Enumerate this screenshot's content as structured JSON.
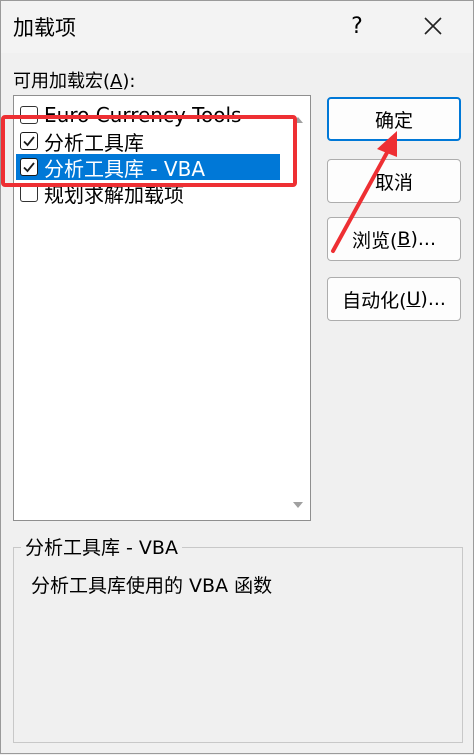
{
  "dialog": {
    "title": "加载项",
    "help_label": "?"
  },
  "addins": {
    "label_prefix": "可用加载宏(",
    "label_accel": "A",
    "label_suffix": "):",
    "items": [
      {
        "label": "Euro Currency Tools",
        "checked": false,
        "selected": false
      },
      {
        "label": "分析工具库",
        "checked": true,
        "selected": false
      },
      {
        "label": "分析工具库 - VBA",
        "checked": true,
        "selected": true
      },
      {
        "label": "规划求解加载项",
        "checked": false,
        "selected": false
      }
    ]
  },
  "buttons": {
    "ok": "确定",
    "cancel": "取消",
    "browse_prefix": "浏览(",
    "browse_accel": "B",
    "browse_suffix": ")...",
    "automation_prefix": "自动化(",
    "automation_accel": "U",
    "automation_suffix": ")..."
  },
  "description": {
    "title": "分析工具库 - VBA",
    "text": "分析工具库使用的 VBA 函数"
  },
  "colors": {
    "selection": "#0078d7",
    "annotation": "#ee2f33"
  }
}
